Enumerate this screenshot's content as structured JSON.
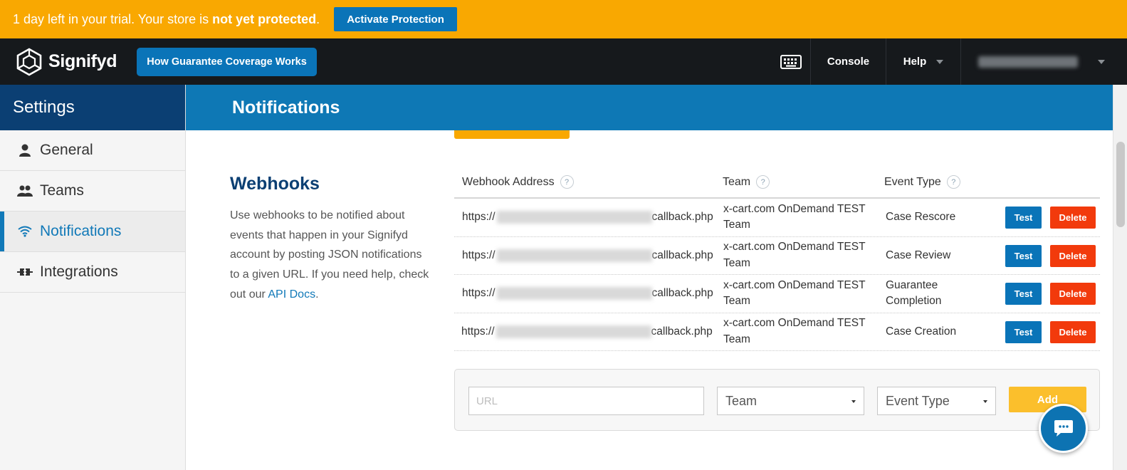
{
  "banner": {
    "text_prefix": "1 day left in your trial. Your store is ",
    "text_bold": "not yet protected",
    "text_suffix": ".",
    "activate_label": "Activate Protection"
  },
  "nav": {
    "brand": "Signifyd",
    "coverage_label": "How Guarantee Coverage Works",
    "keyboard_icon": "keyboard-icon",
    "console_label": "Console",
    "help_label": "Help"
  },
  "sidebar": {
    "title": "Settings",
    "items": [
      {
        "label": "General",
        "icon": "user-icon"
      },
      {
        "label": "Teams",
        "icon": "team-icon"
      },
      {
        "label": "Notifications",
        "icon": "wifi-icon",
        "active": true
      },
      {
        "label": "Integrations",
        "icon": "plug-icon"
      }
    ]
  },
  "page": {
    "title": "Notifications"
  },
  "webhooks": {
    "title": "Webhooks",
    "description": "Use webhooks to be notified about events that happen in your Signifyd account by posting JSON notifications to a given URL. If you need help, check out our ",
    "api_docs_link": "API Docs",
    "description_end": ".",
    "columns": {
      "address": "Webhook Address",
      "team": "Team",
      "event": "Event Type",
      "help_glyph": "?"
    },
    "rows": [
      {
        "url_prefix": "https://",
        "url_suffix": "callback.php",
        "team": "x-cart.com OnDemand TEST Team",
        "event": "Case Rescore"
      },
      {
        "url_prefix": "https://",
        "url_suffix": "callback.php",
        "team": "x-cart.com OnDemand TEST Team",
        "event": "Case Review"
      },
      {
        "url_prefix": "https://",
        "url_suffix": "callback.php",
        "team": "x-cart.com OnDemand TEST Team",
        "event": "Guarantee Completion"
      },
      {
        "url_prefix": "https://",
        "url_suffix": "callback.php",
        "team": "x-cart.com OnDemand TEST Team",
        "event": "Case Creation"
      }
    ],
    "test_label": "Test",
    "delete_label": "Delete",
    "form": {
      "url_placeholder": "URL",
      "team_select": "Team",
      "event_select": "Event Type",
      "add_label": "Add"
    }
  },
  "colors": {
    "banner": "#f9a801",
    "brand_blue": "#0a74b8",
    "delete_red": "#f23a0c",
    "sidebar_head": "#0b3f73"
  }
}
